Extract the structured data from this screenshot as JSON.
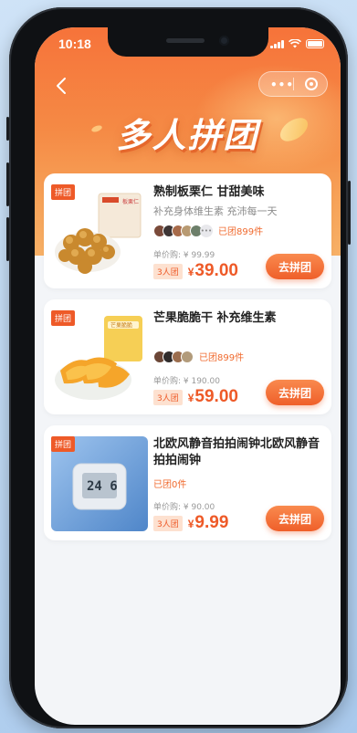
{
  "status_bar": {
    "time": "10:18"
  },
  "banner": {
    "title": "多人拼团"
  },
  "products": [
    {
      "tag": "拼团",
      "title": "熟制板栗仁 甘甜美味",
      "subtitle": "补充身体维生素 充沛每一天",
      "joined": "已团899件",
      "unit_price": "单价购: ¥ 99.99",
      "team_size": "3人团",
      "price_symbol": "¥",
      "price": "39.00",
      "button": "去拼团",
      "package_label": "板栗仁"
    },
    {
      "tag": "拼团",
      "title": "芒果脆脆干 补充维生素",
      "subtitle": "",
      "joined": "已团899件",
      "unit_price": "单价购: ¥ 190.00",
      "team_size": "3人团",
      "price_symbol": "¥",
      "price": "59.00",
      "button": "去拼团",
      "package_label": "芒果脆脆"
    },
    {
      "tag": "拼团",
      "title": "北欧风静音拍拍闹钟北欧风静音拍拍闹钟",
      "subtitle": "",
      "joined": "已团0件",
      "unit_price": "单价购: ¥ 90.00",
      "team_size": "3人团",
      "price_symbol": "¥",
      "price": "9.99",
      "button": "去拼团",
      "clock_display": "24 6"
    }
  ],
  "colors": {
    "accent": "#ee5a28",
    "header_top": "#f6733a",
    "header_bottom": "#f7b066",
    "page_bg": "#f3f5f8"
  },
  "icons": {
    "back": "chevron-left-icon",
    "more": "more-dots-icon",
    "close": "record-circle-icon"
  }
}
